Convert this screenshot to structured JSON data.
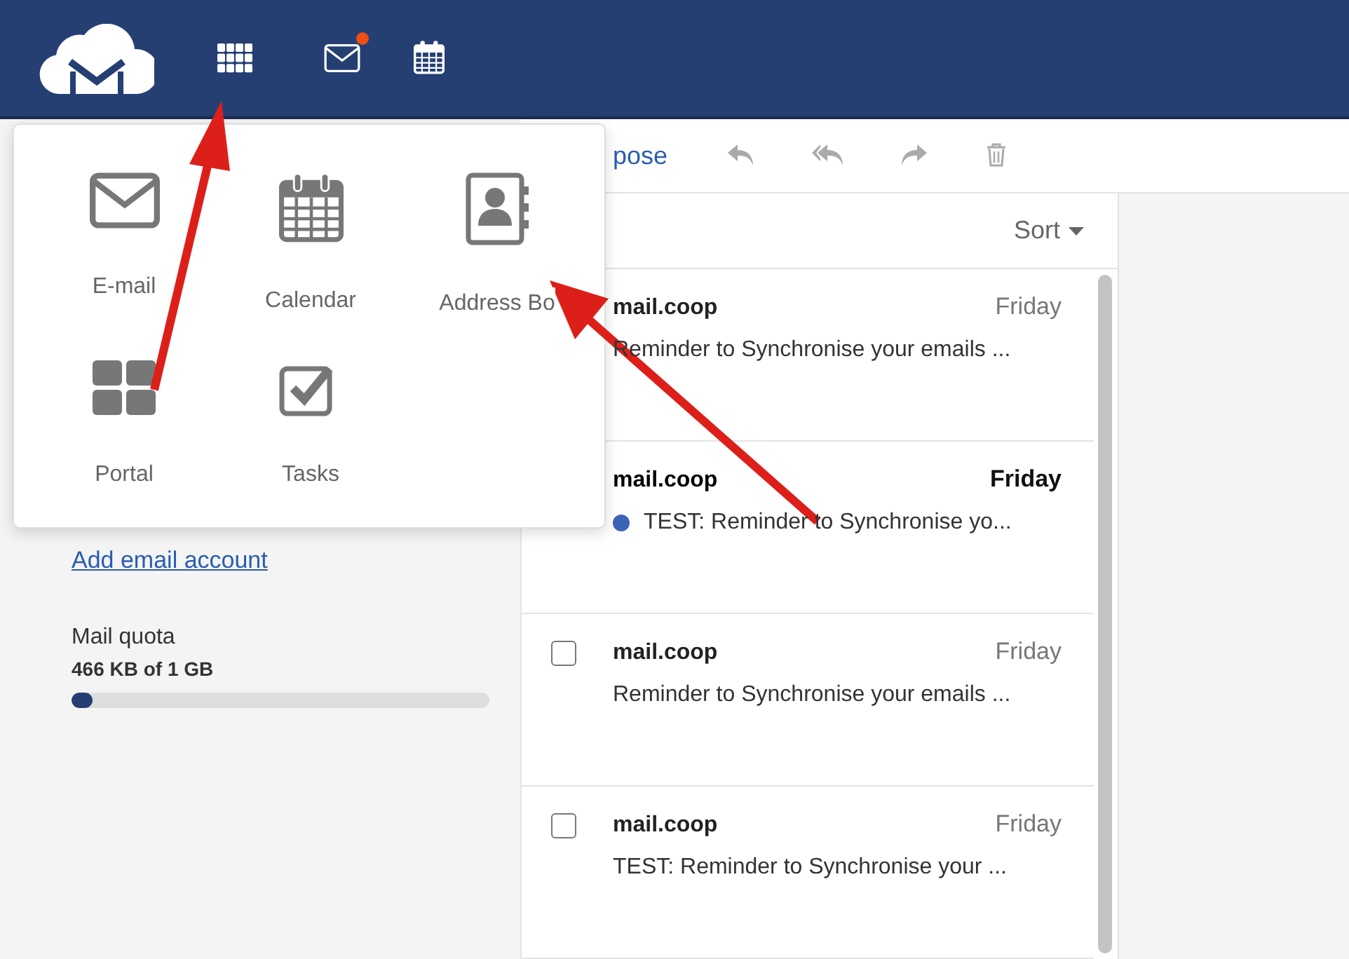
{
  "header": {
    "mail_unread": true
  },
  "apps_menu": {
    "items": [
      {
        "kind": "email",
        "label": "E-mail"
      },
      {
        "kind": "calendar",
        "label": "Calendar"
      },
      {
        "kind": "contacts",
        "label": "Address Bo"
      },
      {
        "kind": "portal",
        "label": "Portal"
      },
      {
        "kind": "tasks",
        "label": "Tasks"
      }
    ]
  },
  "sidebar": {
    "add_account": "Add email account",
    "quota": {
      "label": "Mail quota",
      "usage": "466 KB of 1 GB",
      "level": 0.05
    }
  },
  "toolbar": {
    "compose": "pose"
  },
  "message_list": {
    "sort": "Sort",
    "messages": [
      {
        "sender": "mail.coop",
        "date": "Friday",
        "preview": "Reminder to Synchronise your emails ...",
        "unread": false
      },
      {
        "sender": "mail.coop",
        "date": "Friday",
        "preview": "TEST: Reminder to Synchronise yo...",
        "unread": true
      },
      {
        "sender": "mail.coop",
        "date": "Friday",
        "preview": "Reminder to Synchronise your emails ...",
        "unread": false,
        "checked": false
      },
      {
        "sender": "mail.coop",
        "date": "Friday",
        "preview": "TEST: Reminder to Synchronise your ...",
        "unread": false,
        "checked": false
      }
    ]
  }
}
